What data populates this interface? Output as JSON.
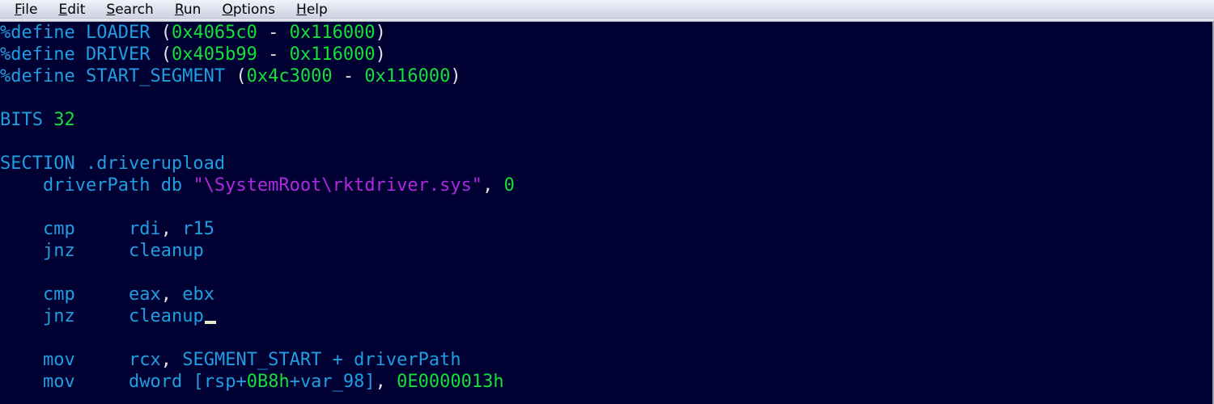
{
  "window": {
    "app_kind": "text-editor",
    "background_color": "#000033"
  },
  "menubar": {
    "items": [
      {
        "label": "File",
        "accel": "F"
      },
      {
        "label": "Edit",
        "accel": "E"
      },
      {
        "label": "Search",
        "accel": "S"
      },
      {
        "label": "Run",
        "accel": "R"
      },
      {
        "label": "Options",
        "accel": "O"
      },
      {
        "label": "Help",
        "accel": "H"
      }
    ]
  },
  "colors": {
    "editor_background": "#000033",
    "keyword": "#1f9ee0",
    "number": "#13e03a",
    "string": "#b028e0",
    "punctuation": "#e8e0e8",
    "menubar_background": "#dcdfe8",
    "cursor": "#e8e8c8"
  },
  "editor": {
    "language": "nasm-assembly",
    "cursor_line": 13,
    "cursor_column": 19,
    "lines": [
      {
        "n": 1,
        "text": "%define LOADER (0x4065c0 - 0x116000)",
        "tokens": [
          {
            "t": "%define",
            "c": "key"
          },
          {
            "t": " ",
            "c": "plain"
          },
          {
            "t": "LOADER",
            "c": "ident"
          },
          {
            "t": " ",
            "c": "plain"
          },
          {
            "t": "(",
            "c": "punc"
          },
          {
            "t": "0x4065c0",
            "c": "num"
          },
          {
            "t": " ",
            "c": "plain"
          },
          {
            "t": "-",
            "c": "punc"
          },
          {
            "t": " ",
            "c": "plain"
          },
          {
            "t": "0x116000",
            "c": "num"
          },
          {
            "t": ")",
            "c": "punc"
          }
        ]
      },
      {
        "n": 2,
        "text": "%define DRIVER (0x405b99 - 0x116000)",
        "tokens": [
          {
            "t": "%define",
            "c": "key"
          },
          {
            "t": " ",
            "c": "plain"
          },
          {
            "t": "DRIVER",
            "c": "ident"
          },
          {
            "t": " ",
            "c": "plain"
          },
          {
            "t": "(",
            "c": "punc"
          },
          {
            "t": "0x405b99",
            "c": "num"
          },
          {
            "t": " ",
            "c": "plain"
          },
          {
            "t": "-",
            "c": "punc"
          },
          {
            "t": " ",
            "c": "plain"
          },
          {
            "t": "0x116000",
            "c": "num"
          },
          {
            "t": ")",
            "c": "punc"
          }
        ]
      },
      {
        "n": 3,
        "text": "%define START_SEGMENT (0x4c3000 - 0x116000)",
        "tokens": [
          {
            "t": "%define",
            "c": "key"
          },
          {
            "t": " ",
            "c": "plain"
          },
          {
            "t": "START_SEGMENT",
            "c": "ident"
          },
          {
            "t": " ",
            "c": "plain"
          },
          {
            "t": "(",
            "c": "punc"
          },
          {
            "t": "0x4c3000",
            "c": "num"
          },
          {
            "t": " ",
            "c": "plain"
          },
          {
            "t": "-",
            "c": "punc"
          },
          {
            "t": " ",
            "c": "plain"
          },
          {
            "t": "0x116000",
            "c": "num"
          },
          {
            "t": ")",
            "c": "punc"
          }
        ]
      },
      {
        "n": 4,
        "text": "",
        "tokens": []
      },
      {
        "n": 5,
        "text": "BITS 32",
        "tokens": [
          {
            "t": "BITS",
            "c": "key"
          },
          {
            "t": " ",
            "c": "plain"
          },
          {
            "t": "32",
            "c": "num"
          }
        ]
      },
      {
        "n": 6,
        "text": "",
        "tokens": []
      },
      {
        "n": 7,
        "text": "SECTION .driverupload",
        "tokens": [
          {
            "t": "SECTION",
            "c": "key"
          },
          {
            "t": " ",
            "c": "plain"
          },
          {
            "t": ".driverupload",
            "c": "ident"
          }
        ]
      },
      {
        "n": 8,
        "text": "    driverPath db \"\\SystemRoot\\rktdriver.sys\", 0",
        "tokens": [
          {
            "t": "    ",
            "c": "plain"
          },
          {
            "t": "driverPath",
            "c": "ident"
          },
          {
            "t": " ",
            "c": "plain"
          },
          {
            "t": "db",
            "c": "key"
          },
          {
            "t": " ",
            "c": "plain"
          },
          {
            "t": "\"\\SystemRoot\\rktdriver.sys\"",
            "c": "str"
          },
          {
            "t": ",",
            "c": "punc"
          },
          {
            "t": " ",
            "c": "plain"
          },
          {
            "t": "0",
            "c": "num"
          }
        ]
      },
      {
        "n": 9,
        "text": "",
        "tokens": []
      },
      {
        "n": 10,
        "text": "    cmp     rdi, r15",
        "tokens": [
          {
            "t": "    ",
            "c": "plain"
          },
          {
            "t": "cmp",
            "c": "key"
          },
          {
            "t": "     ",
            "c": "plain"
          },
          {
            "t": "rdi",
            "c": "ident"
          },
          {
            "t": ",",
            "c": "punc"
          },
          {
            "t": " ",
            "c": "plain"
          },
          {
            "t": "r15",
            "c": "ident"
          }
        ]
      },
      {
        "n": 11,
        "text": "    jnz     cleanup",
        "tokens": [
          {
            "t": "    ",
            "c": "plain"
          },
          {
            "t": "jnz",
            "c": "key"
          },
          {
            "t": "     ",
            "c": "plain"
          },
          {
            "t": "cleanup",
            "c": "ident"
          }
        ]
      },
      {
        "n": 12,
        "text": "",
        "tokens": []
      },
      {
        "n": 13,
        "text": "    cmp     eax, ebx",
        "tokens": [
          {
            "t": "    ",
            "c": "plain"
          },
          {
            "t": "cmp",
            "c": "key"
          },
          {
            "t": "     ",
            "c": "plain"
          },
          {
            "t": "eax",
            "c": "ident"
          },
          {
            "t": ",",
            "c": "punc"
          },
          {
            "t": " ",
            "c": "plain"
          },
          {
            "t": "ebx",
            "c": "ident"
          }
        ]
      },
      {
        "n": 14,
        "text": "    jnz     cleanup",
        "cursor_after": true,
        "tokens": [
          {
            "t": "    ",
            "c": "plain"
          },
          {
            "t": "jnz",
            "c": "key"
          },
          {
            "t": "     ",
            "c": "plain"
          },
          {
            "t": "cleanup",
            "c": "ident"
          }
        ]
      },
      {
        "n": 15,
        "text": "",
        "tokens": []
      },
      {
        "n": 16,
        "text": "    mov     rcx, SEGMENT_START + driverPath",
        "tokens": [
          {
            "t": "    ",
            "c": "plain"
          },
          {
            "t": "mov",
            "c": "key"
          },
          {
            "t": "     ",
            "c": "plain"
          },
          {
            "t": "rcx",
            "c": "ident"
          },
          {
            "t": ",",
            "c": "punc"
          },
          {
            "t": " ",
            "c": "plain"
          },
          {
            "t": "SEGMENT_START",
            "c": "ident"
          },
          {
            "t": " ",
            "c": "plain"
          },
          {
            "t": "+",
            "c": "op"
          },
          {
            "t": " ",
            "c": "plain"
          },
          {
            "t": "driverPath",
            "c": "ident"
          }
        ]
      },
      {
        "n": 17,
        "text": "    mov     dword [rsp+0B8h+var_98], 0E0000013h",
        "tokens": [
          {
            "t": "    ",
            "c": "plain"
          },
          {
            "t": "mov",
            "c": "key"
          },
          {
            "t": "     ",
            "c": "plain"
          },
          {
            "t": "dword",
            "c": "key"
          },
          {
            "t": " ",
            "c": "plain"
          },
          {
            "t": "[",
            "c": "ident"
          },
          {
            "t": "rsp",
            "c": "ident"
          },
          {
            "t": "+",
            "c": "op"
          },
          {
            "t": "0B8h",
            "c": "num"
          },
          {
            "t": "+",
            "c": "op"
          },
          {
            "t": "var_98",
            "c": "ident"
          },
          {
            "t": "]",
            "c": "ident"
          },
          {
            "t": ",",
            "c": "punc"
          },
          {
            "t": " ",
            "c": "plain"
          },
          {
            "t": "0E0000013h",
            "c": "num"
          }
        ]
      }
    ]
  }
}
